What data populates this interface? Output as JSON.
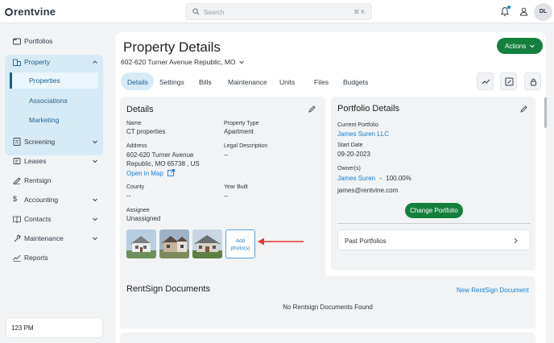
{
  "app": {
    "logo_text": "rentvine"
  },
  "search": {
    "placeholder": "Search",
    "shortcut": "⌘ K"
  },
  "user": {
    "initials": "DL"
  },
  "sidebar": {
    "items": [
      {
        "label": "Portfolios",
        "icon": "portfolio-icon"
      },
      {
        "label": "Property",
        "icon": "property-icon",
        "expanded": true
      },
      {
        "label": "Screening",
        "icon": "screening-icon"
      },
      {
        "label": "Leases",
        "icon": "leases-icon"
      },
      {
        "label": "Rentsign",
        "icon": "rentsign-icon"
      },
      {
        "label": "Accounting",
        "icon": "dollar-icon"
      },
      {
        "label": "Contacts",
        "icon": "contacts-icon"
      },
      {
        "label": "Maintenance",
        "icon": "wrench-icon"
      },
      {
        "label": "Reports",
        "icon": "reports-icon"
      }
    ],
    "property_sub": [
      "Properties",
      "Associations",
      "Marketing"
    ],
    "active_sub": "Properties",
    "time": "123 PM"
  },
  "page": {
    "title": "Property Details",
    "address_select": "602-620 Turner Avenue Republic, MO",
    "actions_label": "Actions",
    "tabs": [
      "Details",
      "Settings",
      "Bills",
      "Maintenance",
      "Units",
      "Files",
      "Budgets"
    ],
    "active_tab": "Details"
  },
  "details": {
    "heading": "Details",
    "name_label": "Name",
    "name_value": "CT properties",
    "type_label": "Property Type",
    "type_value": "Apartment",
    "address_label": "Address",
    "address_line1": "602-620 Turner Avenue",
    "address_line2": "Republic, MO 65738 , US",
    "map_link": "Open in Map",
    "legal_label": "Legal Description",
    "legal_value": "--",
    "county_label": "County",
    "county_value": "--",
    "year_label": "Year Built",
    "year_value": "--",
    "assignee_label": "Assignee",
    "assignee_value": "Unassigned",
    "add_photo_line1": "Add",
    "add_photo_line2": "photo(s)"
  },
  "portfolio": {
    "heading": "Portfolio Details",
    "current_label": "Current Portfolio",
    "current_value": "James Suren LLC",
    "start_label": "Start Date",
    "start_value": "09-20-2023",
    "owners_label": "Owner(s)",
    "owner_name": "James Suren",
    "owner_sep": "-",
    "owner_pct": "100.00%",
    "owner_email": "james@rentvine.com",
    "change_label": "Change Portfolio",
    "past_label": "Past Portfolios"
  },
  "rentsign": {
    "heading": "RentSign Documents",
    "new_link": "New RentSign Document",
    "empty": "No Rentsign Documents Found"
  },
  "colors": {
    "primary_green": "#15803d",
    "accent_blue": "#1b7fd1",
    "nav_highlight": "#d7ebf7"
  }
}
